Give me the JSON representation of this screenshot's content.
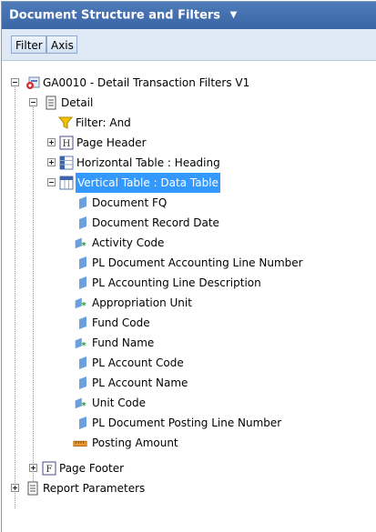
{
  "panel": {
    "title": "Document Structure and Filters",
    "tabs": [
      "Filter",
      "Axis"
    ]
  },
  "tree": {
    "root": "GA0010 - Detail Transaction Filters V1",
    "detail": "Detail",
    "filter": "Filter: And",
    "page_header": "Page Header",
    "horizontal_table": "Horizontal Table : Heading",
    "vertical_table": "Vertical Table : Data Table",
    "columns": [
      "Document FQ",
      "Document Record Date",
      "Activity Code",
      "PL Document Accounting Line Number",
      "PL Accounting Line Description",
      "Appropriation Unit",
      "Fund Code",
      "Fund Name",
      "PL Account Code",
      "PL Account Name",
      "Unit Code",
      "PL Document Posting Line Number",
      "Posting Amount"
    ],
    "page_footer": "Page Footer",
    "report_parameters": "Report Parameters"
  },
  "colors": {
    "title_bar": "#3b66a6",
    "toolbar": "#dfe9f5",
    "selection": "#3399ff"
  }
}
